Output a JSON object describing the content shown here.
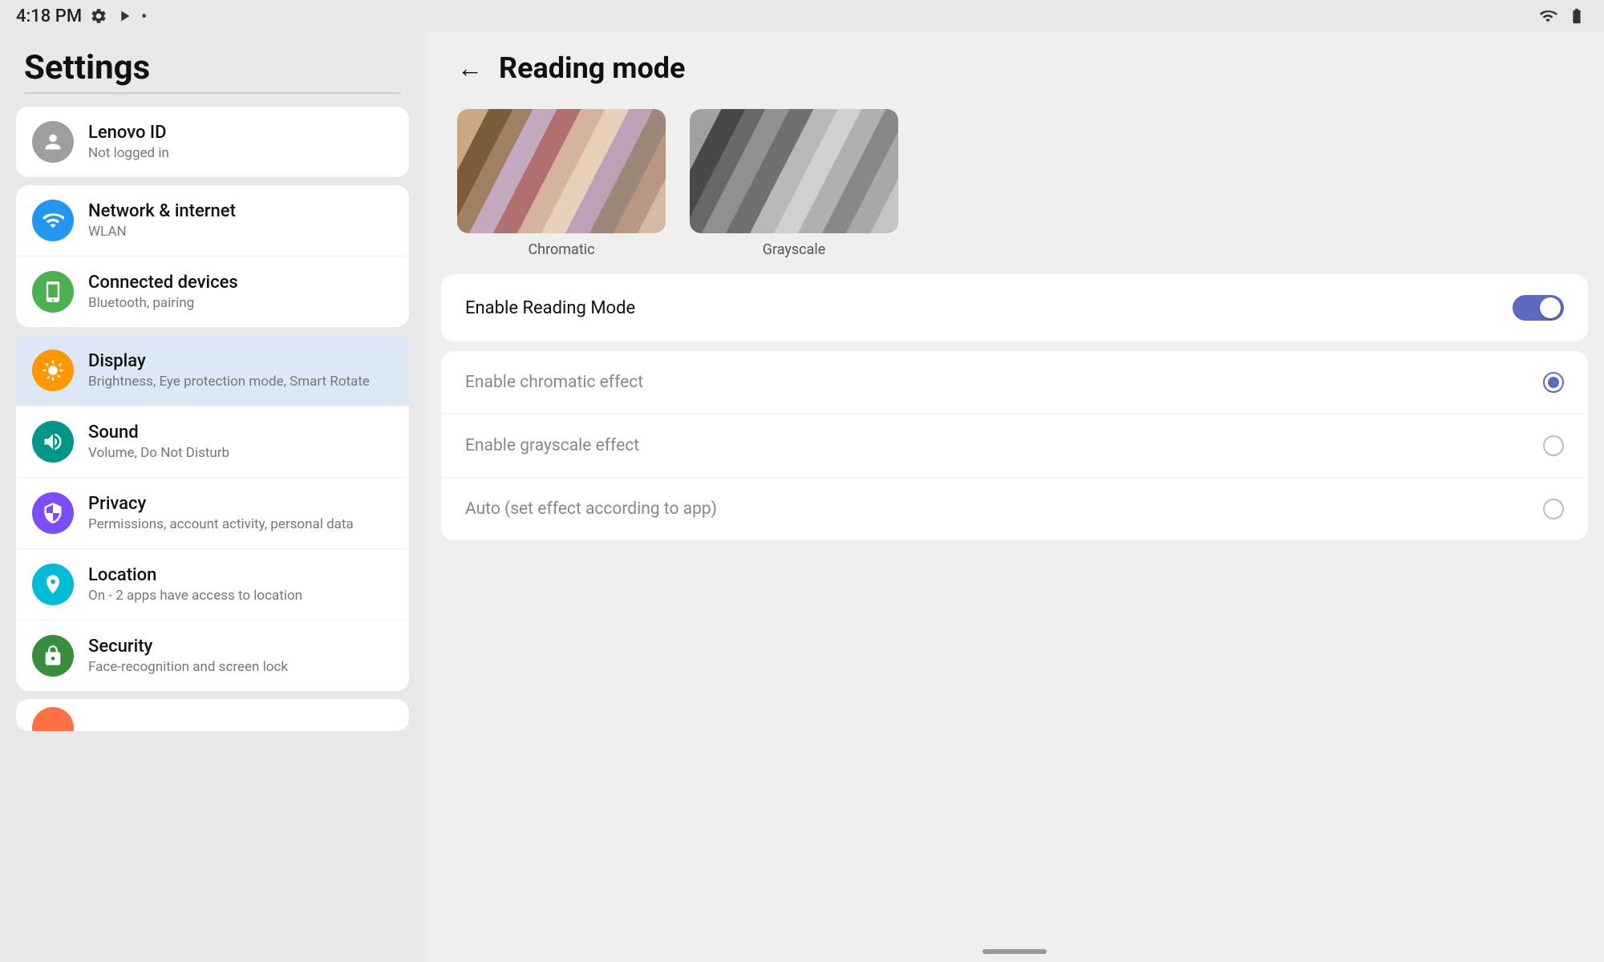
{
  "statusBar": {
    "time": "4:18 PM",
    "wifiIcon": "wifi",
    "batteryIcon": "battery"
  },
  "settingsPanel": {
    "title": "Settings",
    "items": {
      "lenovoId": {
        "label": "Lenovo ID",
        "sublabel": "Not logged in",
        "iconColor": "gray"
      },
      "networkGroup": [
        {
          "label": "Network & internet",
          "sublabel": "WLAN",
          "iconColor": "blue"
        },
        {
          "label": "Connected devices",
          "sublabel": "Bluetooth, pairing",
          "iconColor": "green"
        }
      ],
      "mainGroup": [
        {
          "label": "Display",
          "sublabel": "Brightness, Eye protection mode, Smart Rotate",
          "iconColor": "orange",
          "active": true
        },
        {
          "label": "Sound",
          "sublabel": "Volume, Do Not Disturb",
          "iconColor": "teal"
        },
        {
          "label": "Privacy",
          "sublabel": "Permissions, account activity, personal data",
          "iconColor": "purple"
        },
        {
          "label": "Location",
          "sublabel": "On - 2 apps have access to location",
          "iconColor": "cyan"
        },
        {
          "label": "Security",
          "sublabel": "Face-recognition and screen lock",
          "iconColor": "darkgreen"
        }
      ]
    }
  },
  "readingPanel": {
    "backLabel": "←",
    "title": "Reading mode",
    "swatches": [
      {
        "label": "Chromatic",
        "type": "chromatic"
      },
      {
        "label": "Grayscale",
        "type": "grayscale"
      }
    ],
    "enableLabel": "Enable Reading Mode",
    "toggleEnabled": true,
    "options": [
      {
        "label": "Enable chromatic effect",
        "selected": true
      },
      {
        "label": "Enable grayscale effect",
        "selected": false
      },
      {
        "label": "Auto (set effect according to app)",
        "selected": false
      }
    ]
  }
}
